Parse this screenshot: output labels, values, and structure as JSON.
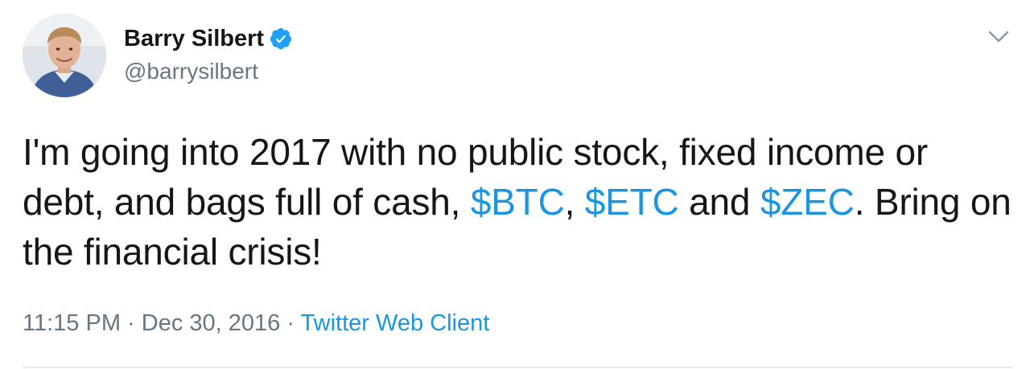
{
  "user": {
    "display_name": "Barry Silbert",
    "handle": "@barrysilbert",
    "verified": true
  },
  "tweet": {
    "text_part1": "I'm going into 2017 with no public stock, fixed income or debt, and bags full of cash, ",
    "cashtag_btc": "$BTC",
    "sep1": ", ",
    "cashtag_etc": "$ETC",
    "sep2": " and ",
    "cashtag_zec": "$ZEC",
    "text_part2": ". Bring on the financial crisis!"
  },
  "meta": {
    "time": "11:15 PM",
    "dot1": " · ",
    "date": "Dec 30, 2016",
    "dot2": " · ",
    "source": "Twitter Web Client"
  },
  "icons": {
    "verified": "verified-badge-icon",
    "caret": "chevron-down-icon"
  },
  "colors": {
    "text": "#14171a",
    "secondary": "#657786",
    "link": "#1b95e0",
    "verified": "#1da1f2",
    "divider": "#e6ecf0"
  }
}
